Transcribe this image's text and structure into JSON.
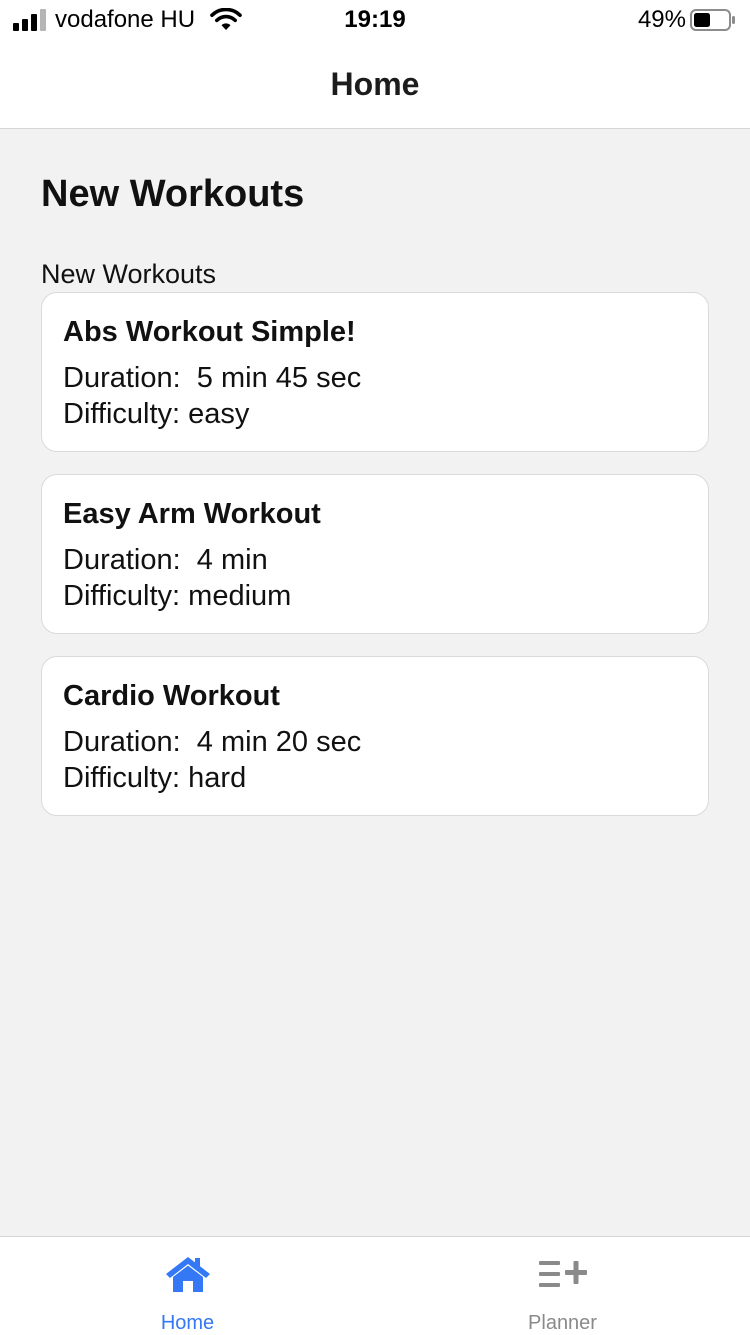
{
  "status_bar": {
    "carrier": "vodafone HU",
    "time": "19:19",
    "battery_percent": "49%",
    "battery_level": 0.49,
    "signal_icon": "signal-bars-icon",
    "wifi_icon": "wifi-icon",
    "battery_icon": "battery-icon"
  },
  "header": {
    "title": "Home"
  },
  "main": {
    "heading": "New Workouts",
    "section_label": "New Workouts",
    "workouts": [
      {
        "title": "Abs Workout Simple!",
        "duration": "Duration:  5 min 45 sec",
        "difficulty": "Difficulty: easy"
      },
      {
        "title": "Easy Arm Workout",
        "duration": "Duration:  4 min",
        "difficulty": "Difficulty: medium"
      },
      {
        "title": "Cardio Workout",
        "duration": "Duration:  4 min 20 sec",
        "difficulty": "Difficulty: hard"
      }
    ]
  },
  "tab_bar": {
    "active_color": "#3478f6",
    "inactive_color": "#8a8a8a",
    "tabs": [
      {
        "label": "Home",
        "icon": "home-icon",
        "active": true
      },
      {
        "label": "Planner",
        "icon": "planner-add-icon",
        "active": false
      }
    ]
  }
}
